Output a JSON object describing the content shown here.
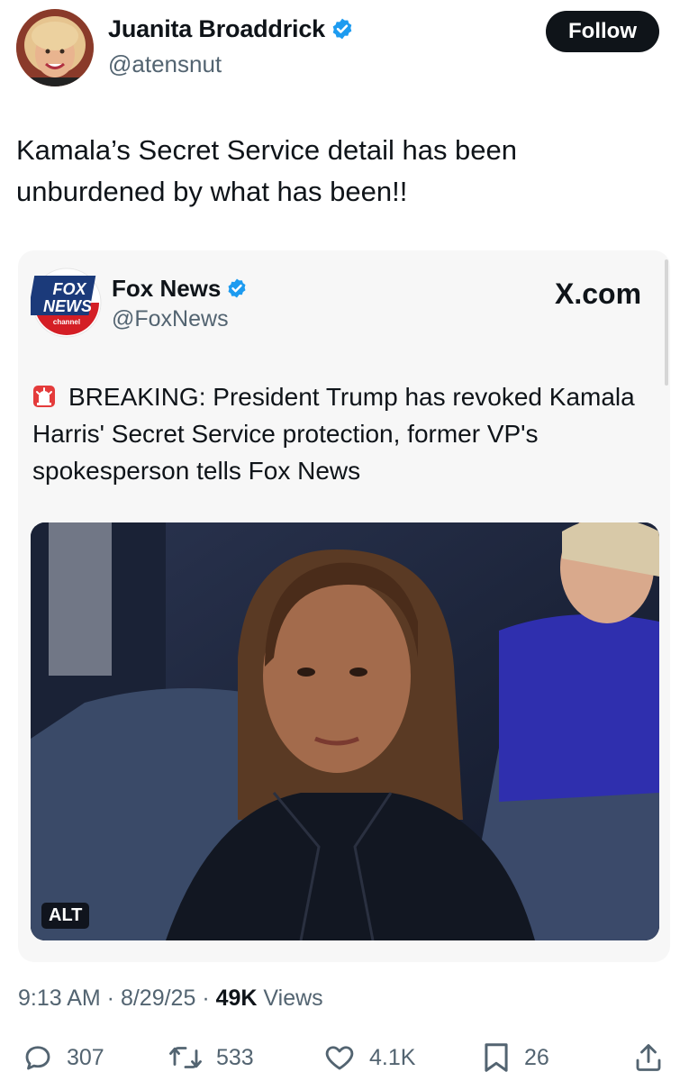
{
  "author": {
    "name": "Juanita Broaddrick",
    "handle": "@atensnut"
  },
  "follow_label": "Follow",
  "tweet_text": "Kamala’s Secret Service detail has been unburdened by what has been!!",
  "quote": {
    "name": "Fox News",
    "handle": "@FoxNews",
    "source": "X.com",
    "logo_text": {
      "top": "FOX",
      "middle": "NEWS",
      "bottom": "channel"
    },
    "text": "BREAKING: President Trump has revoked Kamala Harris' Secret Service protection, former VP's spokesperson tells Fox News",
    "alt_label": "ALT"
  },
  "meta": {
    "time": "9:13 AM",
    "sep1": " · ",
    "date": "8/29/25",
    "sep2": " · ",
    "views_count": "49K",
    "views_label": " Views"
  },
  "actions": {
    "replies": "307",
    "reposts": "533",
    "likes": "4.1K",
    "bookmarks": "26"
  },
  "colors": {
    "verified": "#1d9bf0",
    "fox_blue": "#1b3a7a",
    "fox_red": "#d41e25",
    "text_primary": "#0f1419",
    "text_secondary": "#536471"
  }
}
